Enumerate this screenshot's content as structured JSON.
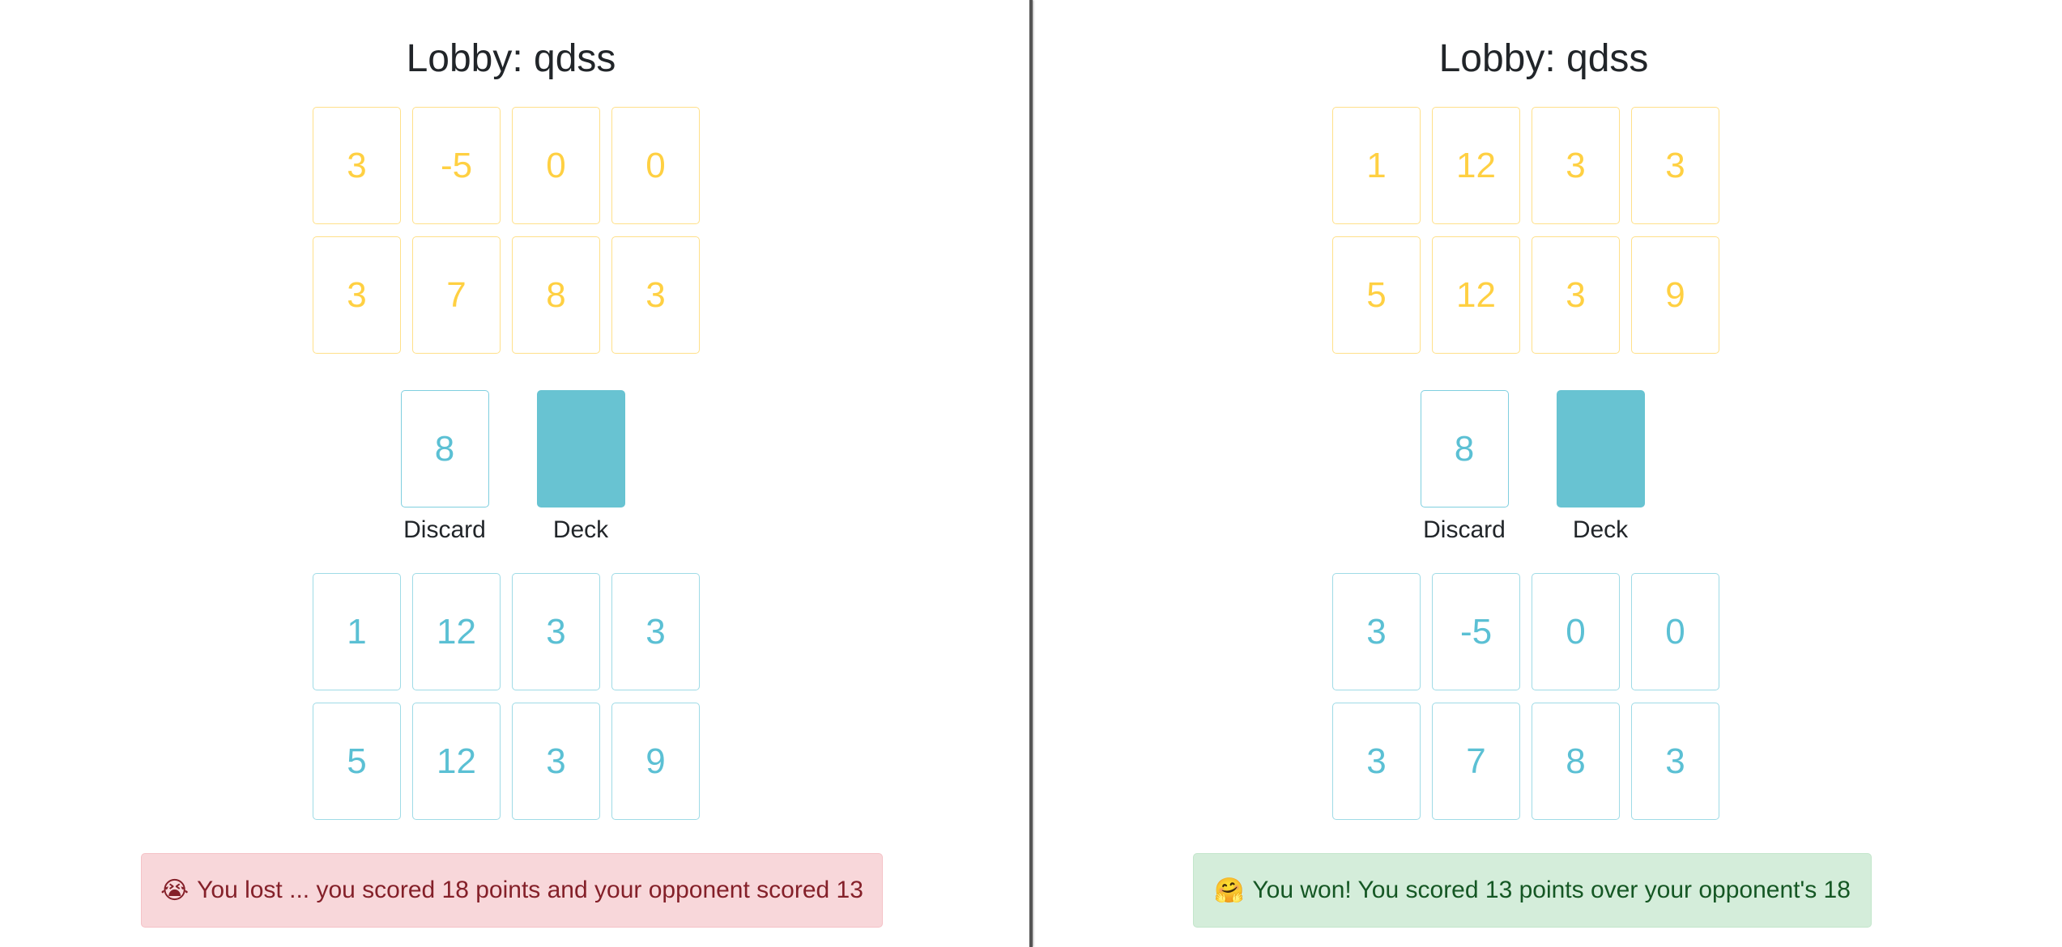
{
  "left": {
    "title": "Lobby: qdss",
    "opponent_cards": [
      "3",
      "-5",
      "0",
      "0",
      "3",
      "7",
      "8",
      "3"
    ],
    "discard_label": "Discard",
    "discard_value": "8",
    "deck_label": "Deck",
    "own_cards": [
      "1",
      "12",
      "3",
      "3",
      "5",
      "12",
      "3",
      "9"
    ],
    "result_emoji": "😭",
    "result_text": "You lost ... you scored 18 points and your opponent scored 13"
  },
  "right": {
    "title": "Lobby: qdss",
    "opponent_cards": [
      "1",
      "12",
      "3",
      "3",
      "5",
      "12",
      "3",
      "9"
    ],
    "discard_label": "Discard",
    "discard_value": "8",
    "deck_label": "Deck",
    "own_cards": [
      "3",
      "-5",
      "0",
      "0",
      "3",
      "7",
      "8",
      "3"
    ],
    "result_emoji": "🤗",
    "result_text": "You won! You scored 13 points over your opponent's 18"
  },
  "colors": {
    "opponent_card_text": "#ffd042",
    "own_card_text": "#5bc0d4",
    "deck_fill": "#68c3d2",
    "loss_alert_bg": "#f8d7da",
    "win_alert_bg": "#d4edda"
  }
}
